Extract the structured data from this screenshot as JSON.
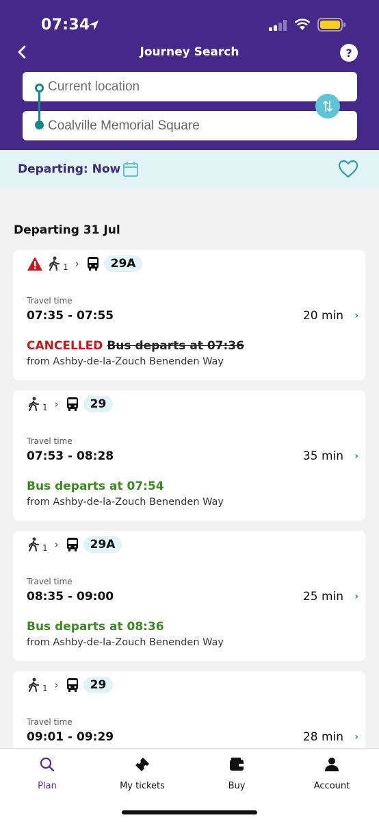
{
  "status_bar": {
    "time": "07:34"
  },
  "header": {
    "title": "Journey Search"
  },
  "search": {
    "from_value": "Current location",
    "to_value": "Coalville Memorial Square"
  },
  "departing": {
    "label": "Departing: Now"
  },
  "section": {
    "title": "Departing 31 Jul"
  },
  "journeys": [
    {
      "walk_count": "1",
      "route": "29A",
      "alert": true,
      "travel_time_label": "Travel time",
      "times": "07:35 - 07:55",
      "duration": "20 min",
      "status": "CANCELLED",
      "departure_text": "Bus departs at 07:36",
      "from_text": "from Ashby-de-la-Zouch Benenden Way"
    },
    {
      "walk_count": "1",
      "route": "29",
      "travel_time_label": "Travel time",
      "times": "07:53 - 08:28",
      "duration": "35 min",
      "departure_text": "Bus departs at 07:54",
      "from_text": "from Ashby-de-la-Zouch Benenden Way"
    },
    {
      "walk_count": "1",
      "route": "29A",
      "travel_time_label": "Travel time",
      "times": "08:35 - 09:00",
      "duration": "25 min",
      "departure_text": "Bus departs at 08:36",
      "from_text": "from Ashby-de-la-Zouch Benenden Way"
    },
    {
      "walk_count": "1",
      "route": "29",
      "travel_time_label": "Travel time",
      "times": "09:01 - 09:29",
      "duration": "28 min"
    }
  ],
  "tabs": [
    {
      "label": "Plan",
      "icon": "search-icon",
      "active": true
    },
    {
      "label": "My tickets",
      "icon": "ticket-icon"
    },
    {
      "label": "Buy",
      "icon": "wallet-icon"
    },
    {
      "label": "Account",
      "icon": "person-icon"
    }
  ],
  "colors": {
    "header": "#45288a",
    "accent_teal": "#0f8a8a",
    "cancelled": "#d0121b",
    "on_time": "#3a8a1e"
  }
}
